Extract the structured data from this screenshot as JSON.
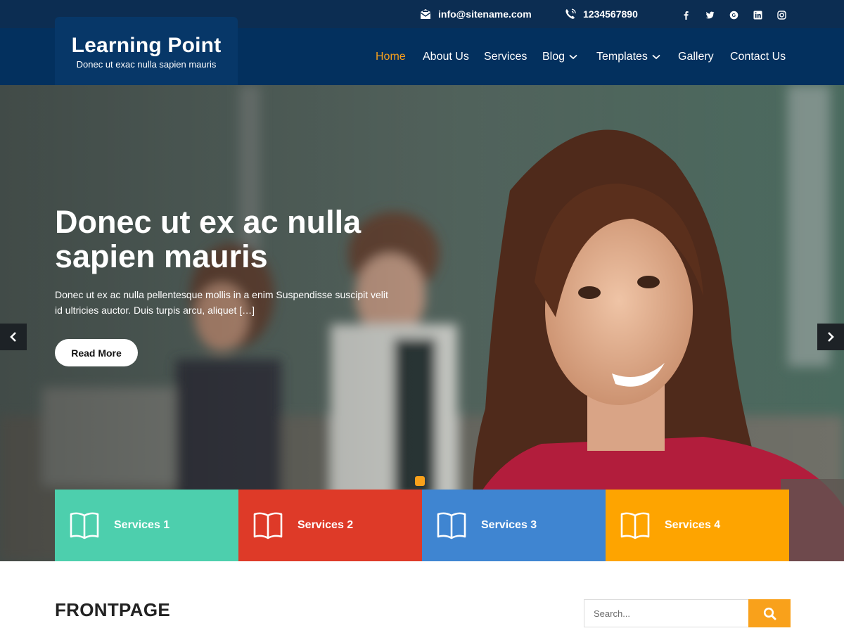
{
  "topbar": {
    "email": "info@sitename.com",
    "phone": "1234567890",
    "social_icons": [
      "facebook-icon",
      "twitter-icon",
      "google-plus-icon",
      "linkedin-icon",
      "instagram-icon"
    ]
  },
  "brand": {
    "title": "Learning Point",
    "tagline": "Donec ut exac nulla sapien mauris"
  },
  "nav": {
    "items": [
      {
        "label": "Home",
        "active": true
      },
      {
        "label": "About Us"
      },
      {
        "label": "Services"
      },
      {
        "label": "Blog",
        "dropdown": true
      },
      {
        "label": "Templates",
        "dropdown": true
      },
      {
        "label": "Gallery"
      },
      {
        "label": "Contact Us"
      }
    ]
  },
  "hero": {
    "title": "Donec ut ex ac nulla sapien mauris",
    "text": "Donec ut ex ac nulla pellentesque mollis in a enim Suspendisse suscipit velit id ultricies auctor. Duis turpis arcu, aliquet […]",
    "button_label": "Read More"
  },
  "services": [
    {
      "label": "Services 1",
      "color": "#4dcfad"
    },
    {
      "label": "Services 2",
      "color": "#de3a28"
    },
    {
      "label": "Services 3",
      "color": "#3f85d1"
    },
    {
      "label": "Services 4",
      "color": "#fea400"
    }
  ],
  "content": {
    "heading": "FRONTPAGE"
  },
  "search": {
    "placeholder": "Search..."
  },
  "colors": {
    "topbar": "#0c2d52",
    "header": "#03305e",
    "accent": "#f9a11b"
  }
}
